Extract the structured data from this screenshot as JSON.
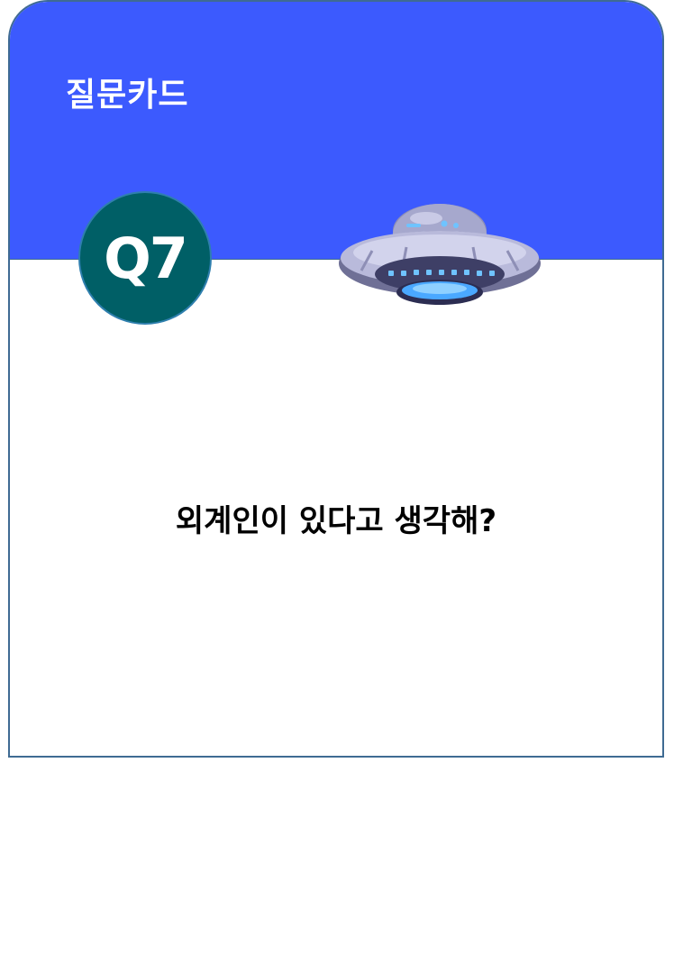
{
  "card": {
    "title": "질문카드",
    "badge": "Q7",
    "question": "외계인이 있다고 생각해?"
  },
  "illustration": {
    "icon": "ufo-icon"
  },
  "colors": {
    "header": "#3c5afe",
    "badge": "#005f66",
    "border": "#3f6b93",
    "text": "#000000",
    "title_text": "#ffffff"
  }
}
